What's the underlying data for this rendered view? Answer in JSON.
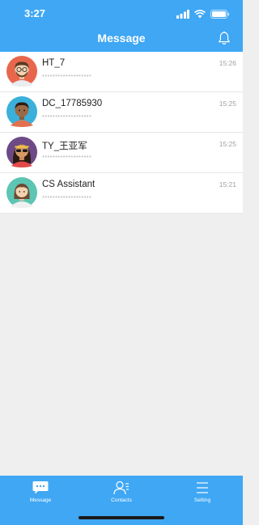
{
  "status_bar": {
    "time": "3:27"
  },
  "header": {
    "title": "Message"
  },
  "conversations": [
    {
      "name": "HT_7",
      "preview": "*******************",
      "time": "15:26"
    },
    {
      "name": "DC_17785930",
      "preview": "*******************",
      "time": "15:25"
    },
    {
      "name": "TY_王亚军",
      "preview": "*******************",
      "time": "15:25"
    },
    {
      "name": "CS Assistant",
      "preview": "*******************",
      "time": "15:21"
    }
  ],
  "tabs": [
    {
      "label": "Message",
      "icon": "chat-bubble-icon"
    },
    {
      "label": "Contacts",
      "icon": "contacts-icon"
    },
    {
      "label": "Setting",
      "icon": "menu-lines-icon"
    }
  ],
  "colors": {
    "primary": "#3fa7f4",
    "background": "#efefef"
  }
}
